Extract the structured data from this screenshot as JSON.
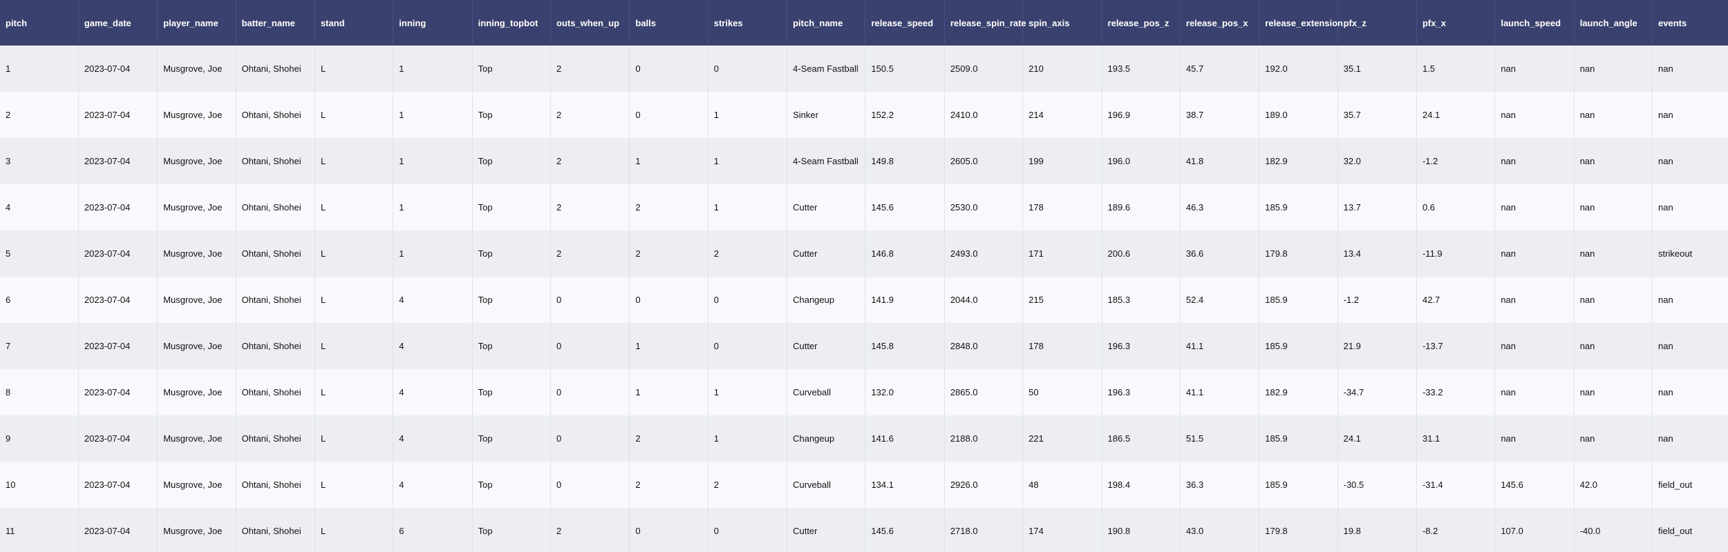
{
  "table": {
    "columns": [
      "pitch",
      "game_date",
      "player_name",
      "batter_name",
      "stand",
      "inning",
      "inning_topbot",
      "outs_when_up",
      "balls",
      "strikes",
      "pitch_name",
      "release_speed",
      "release_spin_rate",
      "spin_axis",
      "release_pos_z",
      "release_pos_x",
      "release_extension",
      "pfx_z",
      "pfx_x",
      "launch_speed",
      "launch_angle",
      "events"
    ],
    "rows": [
      [
        "1",
        "2023-07-04",
        "Musgrove, Joe",
        "Ohtani, Shohei",
        "L",
        "1",
        "Top",
        "2",
        "0",
        "0",
        "4-Seam Fastball",
        "150.5",
        "2509.0",
        "210",
        "193.5",
        "45.7",
        "192.0",
        "35.1",
        "1.5",
        "nan",
        "nan",
        "nan"
      ],
      [
        "2",
        "2023-07-04",
        "Musgrove, Joe",
        "Ohtani, Shohei",
        "L",
        "1",
        "Top",
        "2",
        "0",
        "1",
        "Sinker",
        "152.2",
        "2410.0",
        "214",
        "196.9",
        "38.7",
        "189.0",
        "35.7",
        "24.1",
        "nan",
        "nan",
        "nan"
      ],
      [
        "3",
        "2023-07-04",
        "Musgrove, Joe",
        "Ohtani, Shohei",
        "L",
        "1",
        "Top",
        "2",
        "1",
        "1",
        "4-Seam Fastball",
        "149.8",
        "2605.0",
        "199",
        "196.0",
        "41.8",
        "182.9",
        "32.0",
        "-1.2",
        "nan",
        "nan",
        "nan"
      ],
      [
        "4",
        "2023-07-04",
        "Musgrove, Joe",
        "Ohtani, Shohei",
        "L",
        "1",
        "Top",
        "2",
        "2",
        "1",
        "Cutter",
        "145.6",
        "2530.0",
        "178",
        "189.6",
        "46.3",
        "185.9",
        "13.7",
        "0.6",
        "nan",
        "nan",
        "nan"
      ],
      [
        "5",
        "2023-07-04",
        "Musgrove, Joe",
        "Ohtani, Shohei",
        "L",
        "1",
        "Top",
        "2",
        "2",
        "2",
        "Cutter",
        "146.8",
        "2493.0",
        "171",
        "200.6",
        "36.6",
        "179.8",
        "13.4",
        "-11.9",
        "nan",
        "nan",
        "strikeout"
      ],
      [
        "6",
        "2023-07-04",
        "Musgrove, Joe",
        "Ohtani, Shohei",
        "L",
        "4",
        "Top",
        "0",
        "0",
        "0",
        "Changeup",
        "141.9",
        "2044.0",
        "215",
        "185.3",
        "52.4",
        "185.9",
        "-1.2",
        "42.7",
        "nan",
        "nan",
        "nan"
      ],
      [
        "7",
        "2023-07-04",
        "Musgrove, Joe",
        "Ohtani, Shohei",
        "L",
        "4",
        "Top",
        "0",
        "1",
        "0",
        "Cutter",
        "145.8",
        "2848.0",
        "178",
        "196.3",
        "41.1",
        "185.9",
        "21.9",
        "-13.7",
        "nan",
        "nan",
        "nan"
      ],
      [
        "8",
        "2023-07-04",
        "Musgrove, Joe",
        "Ohtani, Shohei",
        "L",
        "4",
        "Top",
        "0",
        "1",
        "1",
        "Curveball",
        "132.0",
        "2865.0",
        "50",
        "196.3",
        "41.1",
        "182.9",
        "-34.7",
        "-33.2",
        "nan",
        "nan",
        "nan"
      ],
      [
        "9",
        "2023-07-04",
        "Musgrove, Joe",
        "Ohtani, Shohei",
        "L",
        "4",
        "Top",
        "0",
        "2",
        "1",
        "Changeup",
        "141.6",
        "2188.0",
        "221",
        "186.5",
        "51.5",
        "185.9",
        "24.1",
        "31.1",
        "nan",
        "nan",
        "nan"
      ],
      [
        "10",
        "2023-07-04",
        "Musgrove, Joe",
        "Ohtani, Shohei",
        "L",
        "4",
        "Top",
        "0",
        "2",
        "2",
        "Curveball",
        "134.1",
        "2926.0",
        "48",
        "198.4",
        "36.3",
        "185.9",
        "-30.5",
        "-31.4",
        "145.6",
        "42.0",
        "field_out"
      ],
      [
        "11",
        "2023-07-04",
        "Musgrove, Joe",
        "Ohtani, Shohei",
        "L",
        "6",
        "Top",
        "2",
        "0",
        "0",
        "Cutter",
        "145.6",
        "2718.0",
        "174",
        "190.8",
        "43.0",
        "179.8",
        "19.8",
        "-8.2",
        "107.0",
        "-40.0",
        "field_out"
      ]
    ]
  },
  "colors": {
    "header_bg": "#3a416f",
    "row_odd": "#eceef2",
    "row_even": "#f8f9fc"
  }
}
